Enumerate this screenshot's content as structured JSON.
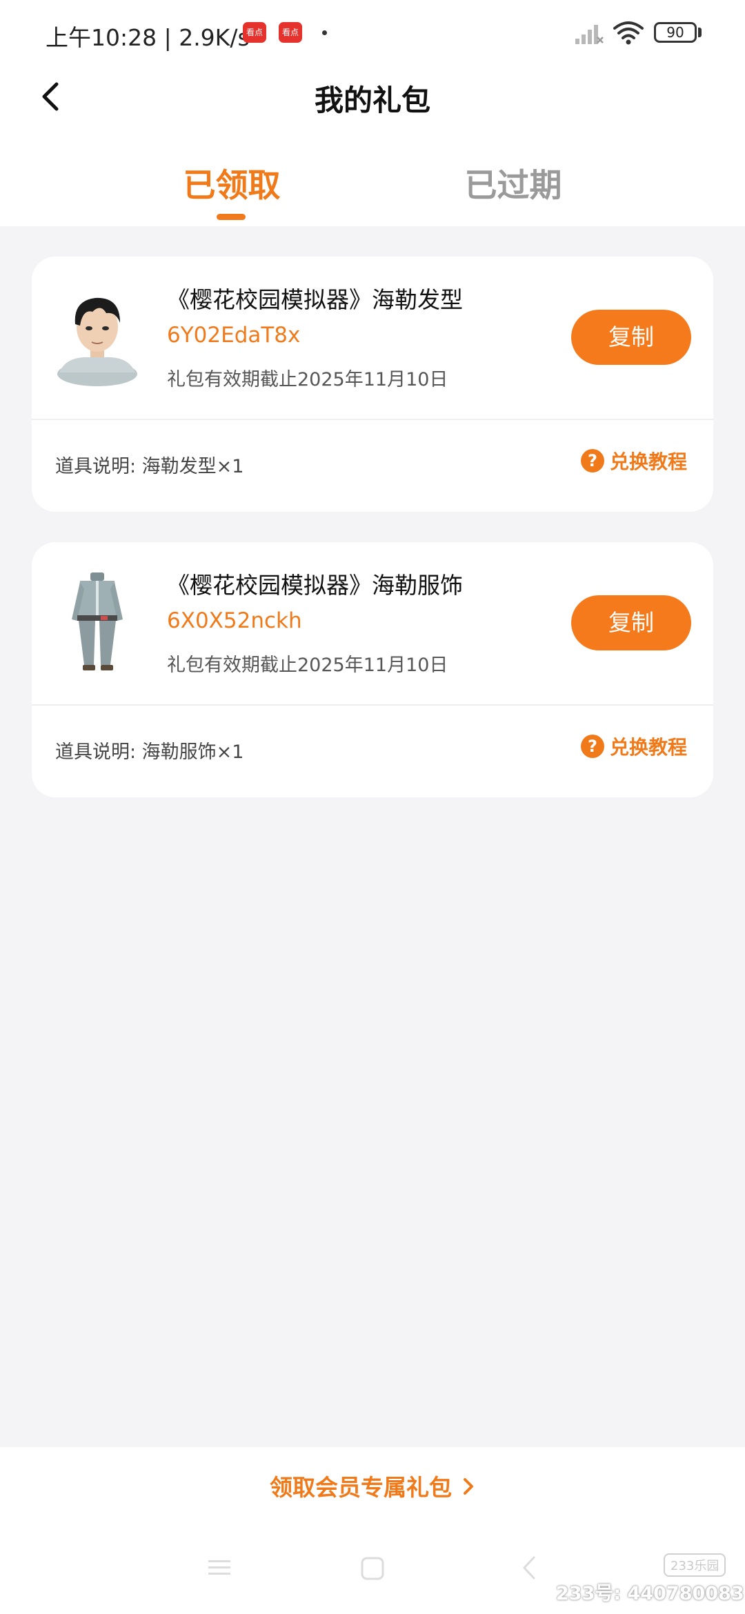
{
  "status_bar": {
    "time_speed": "上午10:28 | 2.9K/s",
    "app_icon_label": "看点",
    "battery": "90"
  },
  "header": {
    "title": "我的礼包"
  },
  "tabs": [
    {
      "label": "已领取",
      "active": true
    },
    {
      "label": "已过期",
      "active": false
    }
  ],
  "gifts": [
    {
      "title": "《樱花校园模拟器》海勒发型",
      "code": "6Y02EdaT8x",
      "expiry": "礼包有效期截止2025年11月10日",
      "copy_label": "复制",
      "description": "道具说明: 海勒发型×1",
      "tutorial_label": "兑换教程",
      "thumb_icon": "character-head-image"
    },
    {
      "title": "《樱花校园模拟器》海勒服饰",
      "code": "6X0X52nckh",
      "expiry": "礼包有效期截止2025年11月10日",
      "copy_label": "复制",
      "description": "道具说明: 海勒服饰×1",
      "tutorial_label": "兑换教程",
      "thumb_icon": "outfit-image"
    }
  ],
  "footer": {
    "member_gift_label": "领取会员专属礼包"
  },
  "watermark": {
    "logo": "233乐园",
    "text": "233号: 440780083"
  },
  "colors": {
    "accent": "#f07a1a",
    "background": "#f4f4f6",
    "card": "#ffffff"
  }
}
